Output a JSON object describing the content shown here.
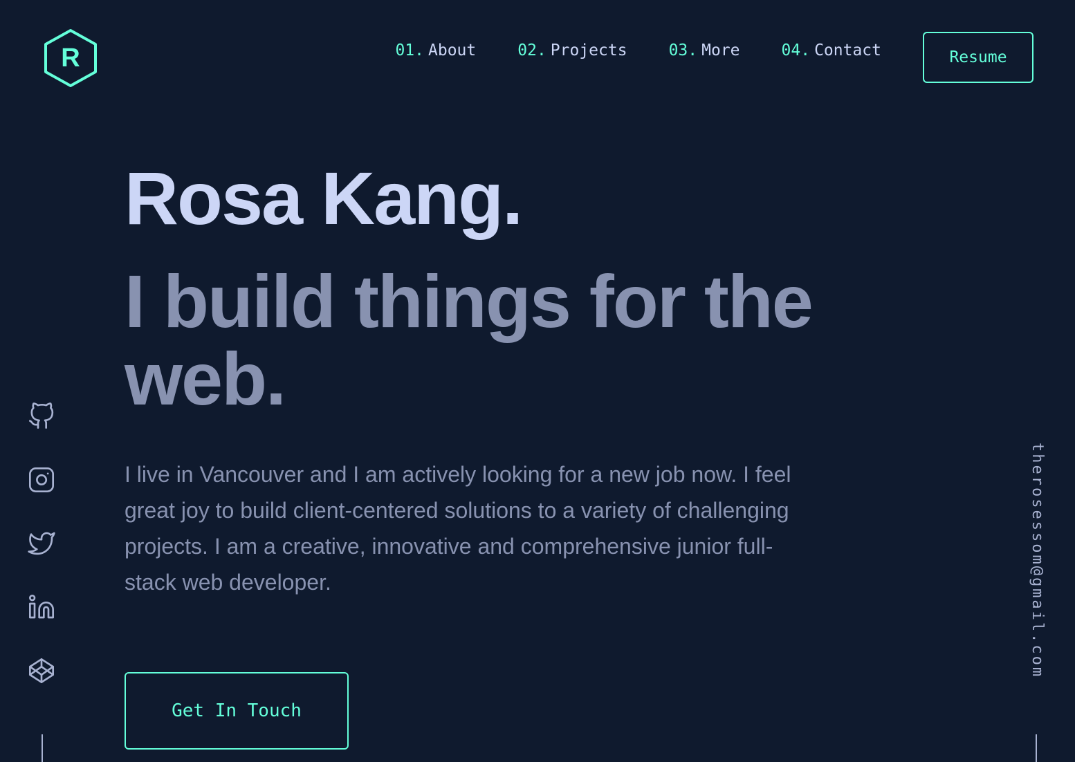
{
  "colors": {
    "background": "#0f1a2e",
    "accent": "#64ffda",
    "heading": "#ccd6f6",
    "muted": "#8892b0"
  },
  "header": {
    "logo_letter": "R",
    "nav": [
      {
        "num": "01.",
        "label": "About"
      },
      {
        "num": "02.",
        "label": "Projects"
      },
      {
        "num": "03.",
        "label": "More"
      },
      {
        "num": "04.",
        "label": "Contact"
      }
    ],
    "resume_label": "Resume"
  },
  "hero": {
    "name": "Rosa Kang.",
    "tagline": "I build things for the web.",
    "description": "I live in Vancouver and I am actively looking for a new job now. I feel great joy to build client-centered solutions to a variety of challenging projects. I am a creative, innovative and comprehensive junior full-stack web developer.",
    "cta_label": "Get In Touch"
  },
  "social": [
    {
      "icon": "github-icon"
    },
    {
      "icon": "instagram-icon"
    },
    {
      "icon": "twitter-icon"
    },
    {
      "icon": "linkedin-icon"
    },
    {
      "icon": "codepen-icon"
    }
  ],
  "email": "therosessom@gmail.com"
}
